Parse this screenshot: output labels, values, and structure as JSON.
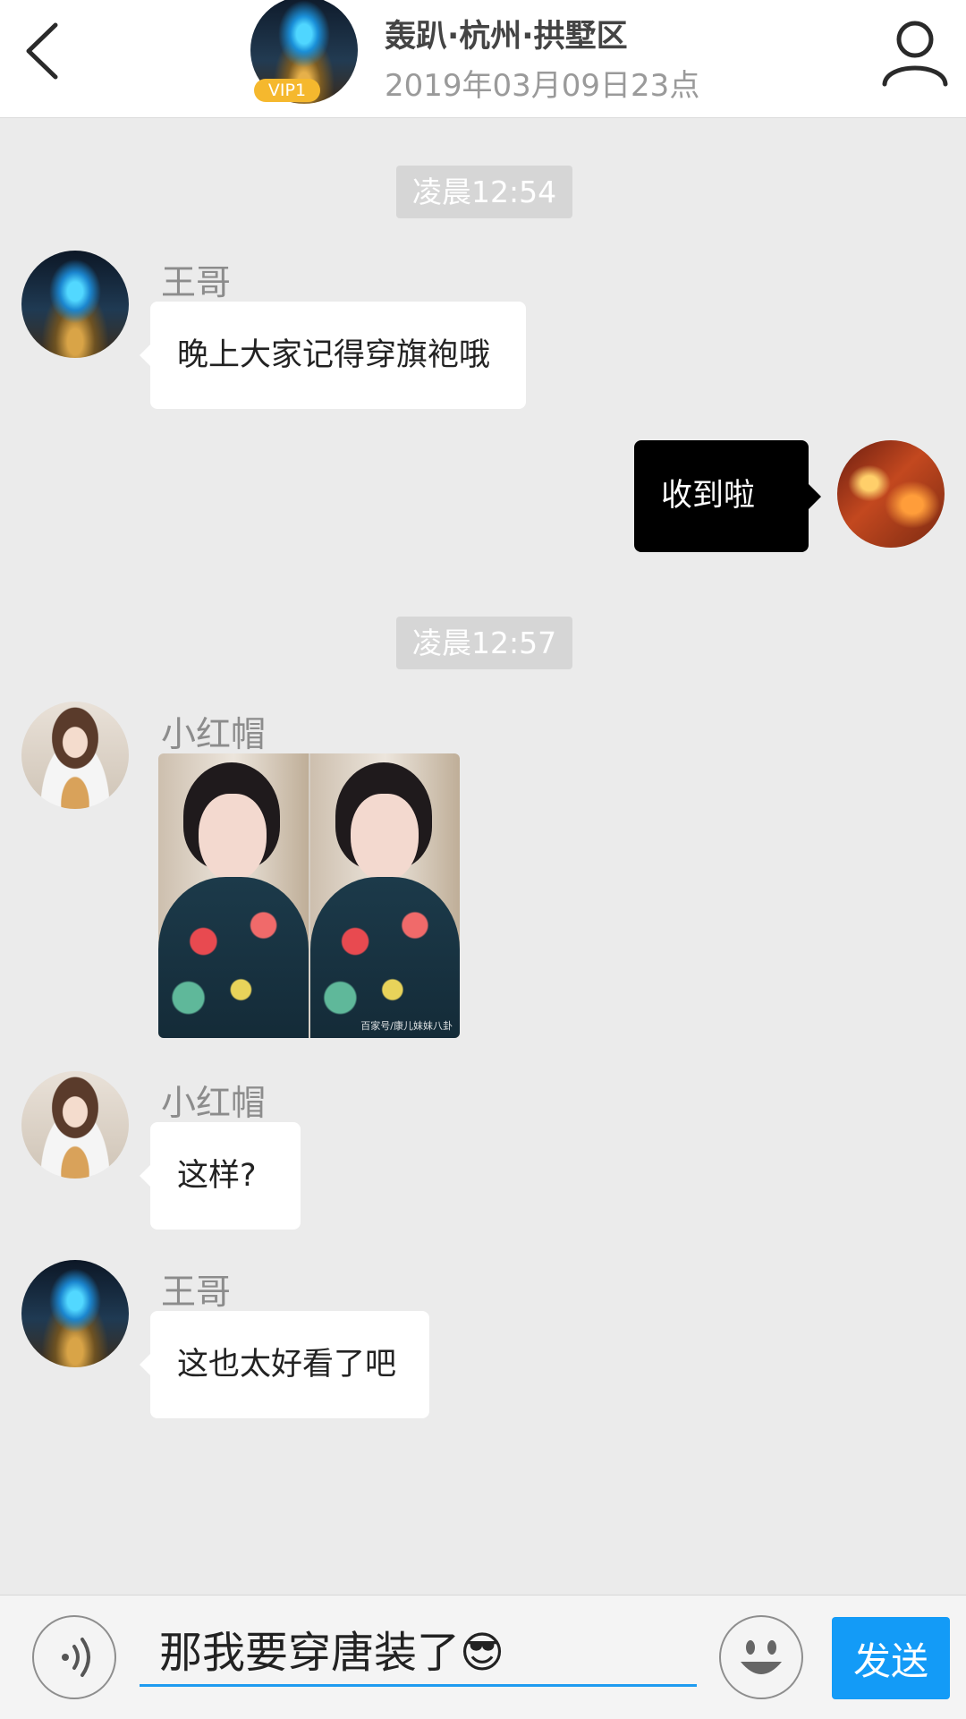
{
  "header": {
    "title": "轰趴·杭州·拱墅区",
    "subtitle": "2019年03月09日23点",
    "vip_badge": "VIP1"
  },
  "messages": [
    {
      "type": "time",
      "text": "凌晨12:54"
    },
    {
      "type": "text",
      "side": "left",
      "sender": "王哥",
      "text": "晚上大家记得穿旗袍哦"
    },
    {
      "type": "text",
      "side": "right",
      "text": "收到啦"
    },
    {
      "type": "time",
      "text": "凌晨12:57"
    },
    {
      "type": "image",
      "side": "left",
      "sender": "小红帽",
      "watermark": "百家号/康儿妹妹八卦"
    },
    {
      "type": "text",
      "side": "left",
      "sender": "小红帽",
      "text": "这样?"
    },
    {
      "type": "text",
      "side": "left",
      "sender": "王哥",
      "text": "这也太好看了吧"
    }
  ],
  "input": {
    "value": "那我要穿唐装了",
    "emoji": "😎",
    "send_label": "发送"
  },
  "icons": {
    "back": "chevron-left-icon",
    "user": "user-icon",
    "voice": "voice-icon",
    "emoji": "emoji-smile-icon"
  },
  "colors": {
    "accent": "#139bf7",
    "vip": "#f5b82e",
    "my_bubble": "#000000",
    "other_bubble": "#ffffff",
    "background": "#ebebeb"
  }
}
